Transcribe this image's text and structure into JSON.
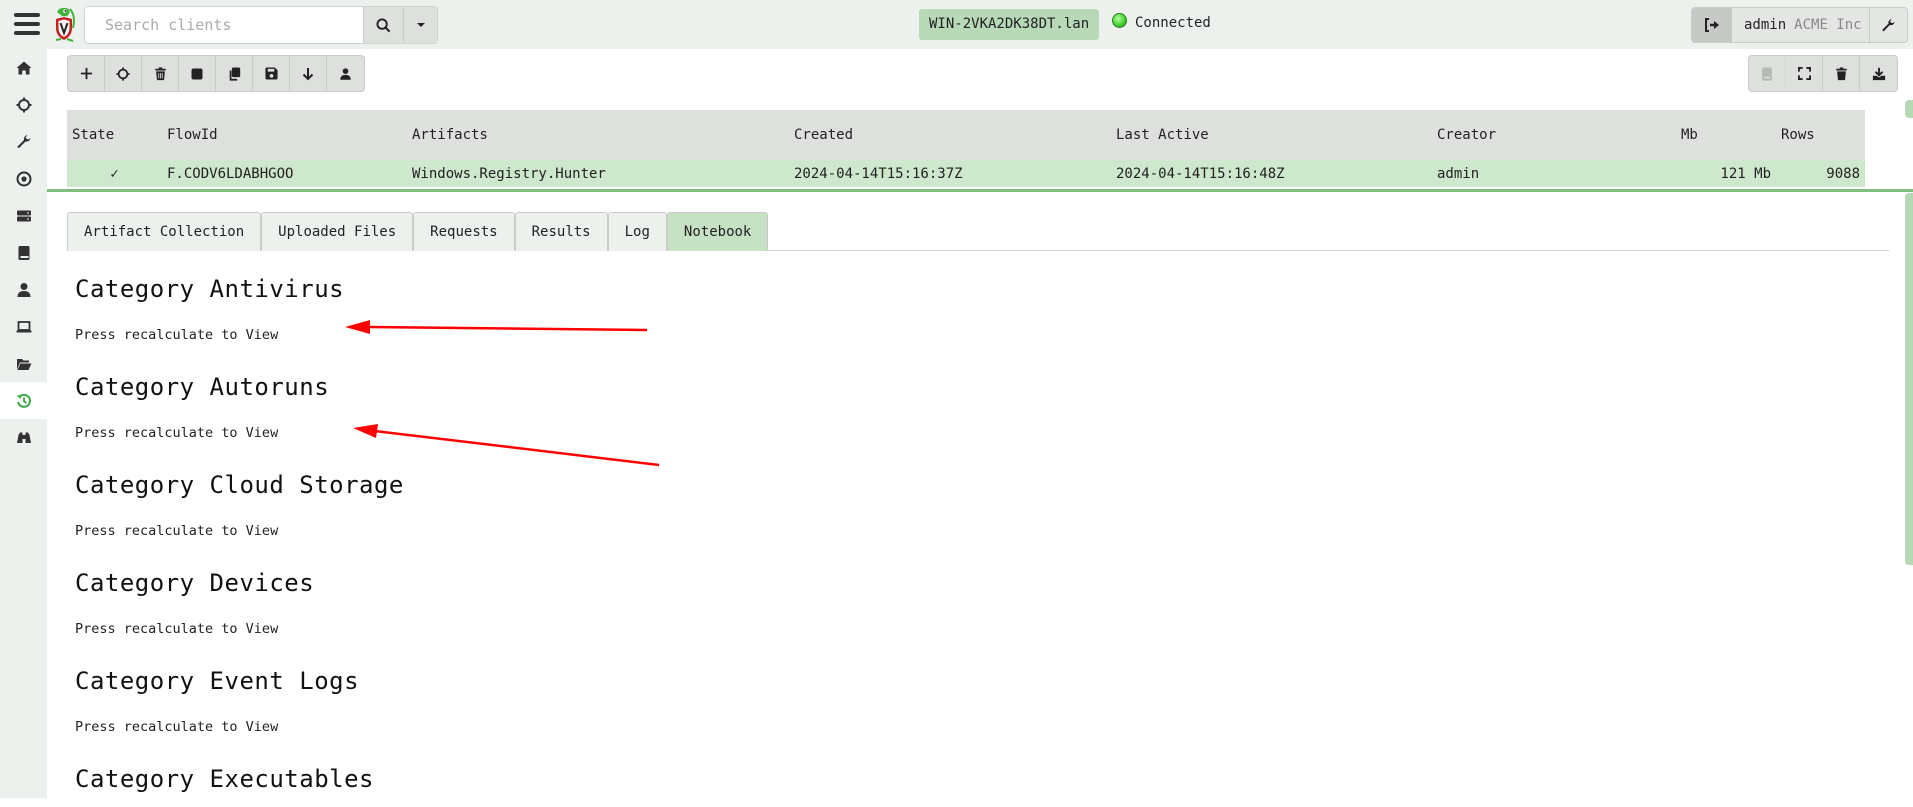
{
  "header": {
    "search": {
      "placeholder": "Search clients",
      "value": ""
    },
    "client_hostname": "WIN-2VKA2DK38DT.lan",
    "connection_status": "Connected",
    "connection_color": "#3bcf2a",
    "user": {
      "name": "admin",
      "org": "ACME Inc"
    },
    "icons": {
      "menu": "hamburger-icon",
      "logo": "velociraptor-logo",
      "search": "search-icon",
      "dropdown": "caret-down-icon",
      "logout": "sign-out-icon",
      "settings": "wrench-icon"
    }
  },
  "sidebar": {
    "items": [
      {
        "icon": "home-icon",
        "active": false
      },
      {
        "icon": "crosshairs-icon",
        "active": false
      },
      {
        "icon": "wrench-icon",
        "active": false
      },
      {
        "icon": "eye-icon",
        "active": false
      },
      {
        "icon": "server-icon",
        "active": false
      },
      {
        "icon": "book-icon",
        "active": false
      },
      {
        "icon": "user-icon",
        "active": false
      },
      {
        "icon": "laptop-icon",
        "active": false
      },
      {
        "icon": "folder-open-icon",
        "active": false
      },
      {
        "icon": "history-icon",
        "active": true
      },
      {
        "icon": "binoculars-icon",
        "active": false
      }
    ],
    "active_color": "#3aa843"
  },
  "toolbar": {
    "left": [
      "plus-icon",
      "crosshairs-icon",
      "trash-icon",
      "stop-icon",
      "copy-icon",
      "save-icon",
      "download-arrow-icon",
      "user-icon"
    ],
    "right": [
      "notebook-icon",
      "expand-icon",
      "trash-icon",
      "download-icon"
    ]
  },
  "flows_table": {
    "columns": [
      "State",
      "FlowId",
      "Artifacts",
      "Created",
      "Last Active",
      "Creator",
      "Mb",
      "Rows"
    ],
    "rows": [
      {
        "state": "✓",
        "flow_id": "F.CODV6LDABHGOO",
        "artifacts": "Windows.Registry.Hunter",
        "created": "2024-04-14T15:16:37Z",
        "last_active": "2024-04-14T15:16:48Z",
        "creator": "admin",
        "mb": "121 Mb",
        "rows": "9088"
      }
    ]
  },
  "tabs": [
    {
      "label": "Artifact Collection",
      "active": false
    },
    {
      "label": "Uploaded Files",
      "active": false
    },
    {
      "label": "Requests",
      "active": false
    },
    {
      "label": "Results",
      "active": false
    },
    {
      "label": "Log",
      "active": false
    },
    {
      "label": "Notebook",
      "active": true
    }
  ],
  "notebook": {
    "cells": [
      {
        "title": "Category Antivirus",
        "body": "Press recalculate to View"
      },
      {
        "title": "Category Autoruns",
        "body": "Press recalculate to View"
      },
      {
        "title": "Category Cloud Storage",
        "body": "Press recalculate to View"
      },
      {
        "title": "Category Devices",
        "body": "Press recalculate to View"
      },
      {
        "title": "Category Event Logs",
        "body": "Press recalculate to View"
      },
      {
        "title": "Category Executables",
        "body": ""
      }
    ]
  },
  "annotations": {
    "arrow_color": "#ff0000",
    "arrows_point_to": [
      "Category Antivirus body",
      "Category Autoruns body"
    ]
  }
}
